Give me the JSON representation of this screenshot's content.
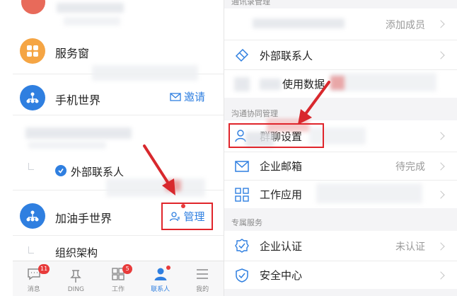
{
  "left": {
    "rows": {
      "service_window": "服务窗",
      "phone_world": "手机世界",
      "invite": "邀请",
      "external_contacts": "外部联系人",
      "jiayou_world": "加油手世界",
      "manage": "管理",
      "org_structure": "组织架构"
    },
    "tabbar": [
      {
        "label": "消息",
        "badge": "11",
        "icon": "message-icon"
      },
      {
        "label": "DING",
        "badge": "",
        "icon": "pin-icon"
      },
      {
        "label": "工作",
        "badge": "5",
        "icon": "grid-icon"
      },
      {
        "label": "联系人",
        "badge": "",
        "icon": "contacts-icon",
        "active": true
      },
      {
        "label": "我的",
        "badge": "",
        "icon": "menu-icon"
      }
    ]
  },
  "right": {
    "section_contacts": "通讯录管理",
    "add_member": "添加成员",
    "external_contacts": "外部联系人",
    "usage_data": "使用数据",
    "section_collab": "沟通协同管理",
    "group_settings": "群聊设置",
    "enterprise_mail": "企业邮箱",
    "enterprise_mail_value": "待完成",
    "work_apps": "工作应用",
    "section_exclusive": "专属服务",
    "enterprise_cert": "企业认证",
    "enterprise_cert_value": "未认证",
    "security_center": "安全中心"
  },
  "colors": {
    "accent": "#2f7fe0",
    "highlight": "#e0252b",
    "orange": "#f5a544",
    "badge": "#e83b3b"
  }
}
